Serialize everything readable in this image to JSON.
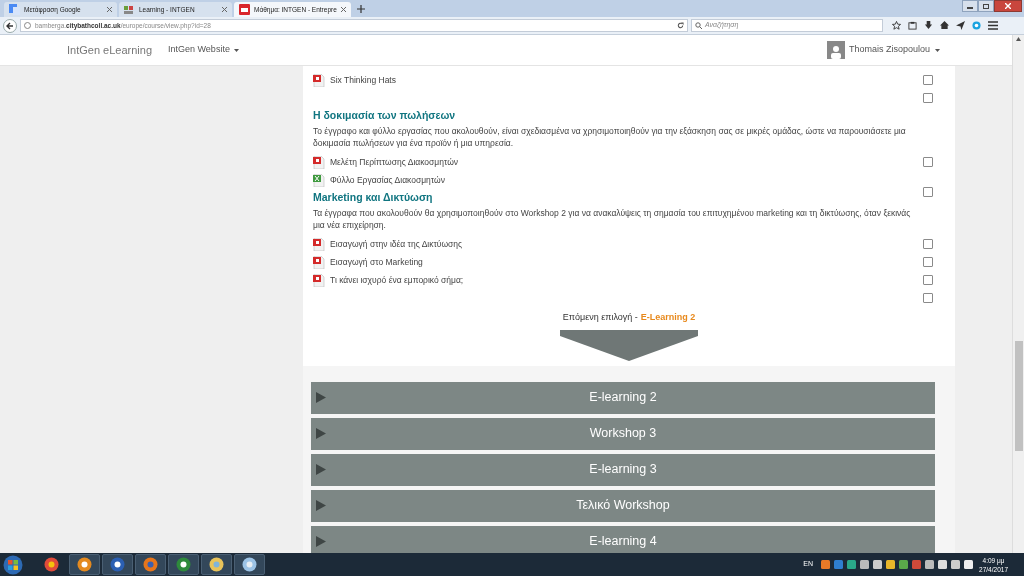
{
  "browser": {
    "tabs": [
      {
        "title": "Μετάφραση Google",
        "selected": false
      },
      {
        "title": "Learning - INTGEN",
        "selected": false
      },
      {
        "title": "Μάθημα: INTGEN - Entrepre",
        "selected": true
      }
    ],
    "url_host": "bamberga.",
    "url_domain": "citybathcoll.ac.uk",
    "url_path": "/europe/course/view.php?id=28",
    "search_placeholder": "Αναζήτηση"
  },
  "navbar": {
    "brand": "IntGen eLearning",
    "menu": "IntGen Website",
    "user": "Thomais Zisopoulou"
  },
  "items": [
    {
      "kind": "pdf",
      "label": "Six Thinking Hats",
      "checked": false
    },
    {
      "kind": "check",
      "checked": false
    },
    {
      "kind": "section",
      "title": "Η δοκιμασία των πωλήσεων",
      "text": "Το έγγραφο και φύλλο εργασίας που ακολουθούν, είναι σχεδιασμένα να χρησιμοποιηθούν για την εξάσκηση σας σε μικρές ομάδας, ώστε να παρουσιάσετε μια δοκιμασία πωλήσεων για ένα προϊόν ή μια υπηρεσία."
    },
    {
      "kind": "pdf",
      "label": "Μελέτη Περίπτωσης Διακοσμητών",
      "checked": false
    },
    {
      "kind": "sheet",
      "label": "Φύλλο Εργασίας Διακοσμητών"
    },
    {
      "kind": "section",
      "title": "Marketing και Δικτύωση",
      "text": "Τα έγγραφα που ακολουθούν θα χρησιμοποιηθούν στο Workshop 2 για να ανακαλύψεις τη σημασία του επιτυχημένου marketing και τη δικτύωσης, όταν ξεκινάς μια νέα επιχείρηση.",
      "checked": false
    },
    {
      "kind": "pdf",
      "label": "Εισαγωγή στην ιδέα της Δικτύωσης",
      "checked": false
    },
    {
      "kind": "pdf",
      "label": "Εισαγωγή στο Marketing",
      "checked": false
    },
    {
      "kind": "pdf",
      "label": "Τι κάνει ισχυρό ένα εμπορικό σήμα;",
      "checked": false
    },
    {
      "kind": "check",
      "checked": false
    }
  ],
  "next": {
    "prefix": "Επόμενη επιλογή -",
    "link": "E-Learning 2"
  },
  "sections": [
    "E-learning 2",
    "Workshop 3",
    "E-learning 3",
    "Τελικό Workshop",
    "E-learning 4"
  ],
  "taskbar": {
    "language": "EN",
    "time": "4:09 μμ",
    "date": "27/4/2017"
  }
}
